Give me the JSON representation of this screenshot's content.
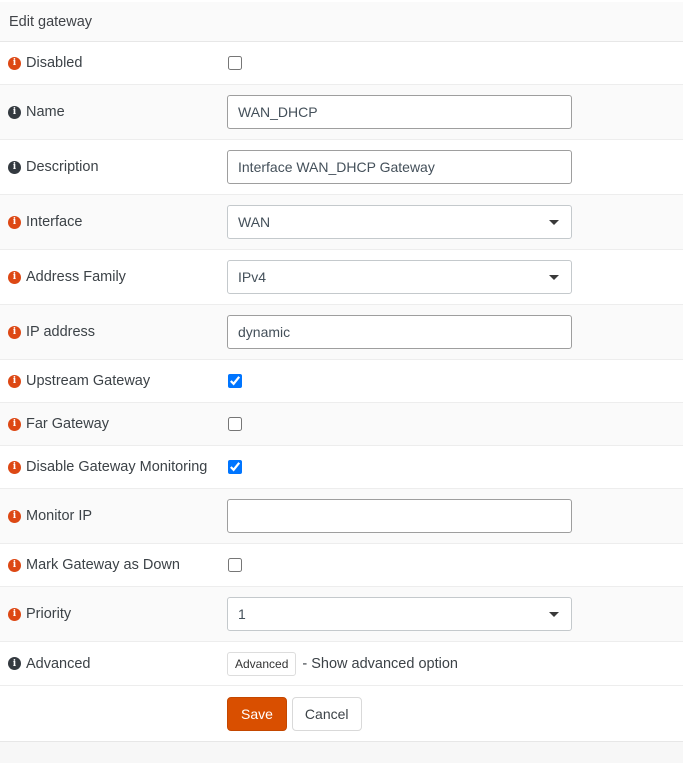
{
  "header": {
    "title": "Edit gateway"
  },
  "colors": {
    "primary": "#d94f00",
    "icon-orange": "#dd4814",
    "icon-dark": "#343a40",
    "checkbox": "#0075ff",
    "stripe": "#fafafa",
    "border": "#ededed"
  },
  "form": {
    "rows": [
      {
        "id": "disabled",
        "label": "Disabled",
        "type": "checkbox",
        "checked": false,
        "icon": "info-icon-orange"
      },
      {
        "id": "name",
        "label": "Name",
        "type": "text",
        "value": "WAN_DHCP",
        "icon": "info-icon-dark"
      },
      {
        "id": "description",
        "label": "Description",
        "type": "text",
        "value": "Interface WAN_DHCP Gateway",
        "icon": "info-icon-dark"
      },
      {
        "id": "interface",
        "label": "Interface",
        "type": "select",
        "value": "WAN",
        "icon": "info-icon-orange"
      },
      {
        "id": "address_family",
        "label": "Address Family",
        "type": "select",
        "value": "IPv4",
        "icon": "info-icon-orange"
      },
      {
        "id": "ip_address",
        "label": "IP address",
        "type": "text",
        "value": "dynamic",
        "icon": "info-icon-orange"
      },
      {
        "id": "upstream_gateway",
        "label": "Upstream Gateway",
        "type": "checkbox",
        "checked": true,
        "icon": "info-icon-orange"
      },
      {
        "id": "far_gateway",
        "label": "Far Gateway",
        "type": "checkbox",
        "checked": false,
        "icon": "info-icon-orange"
      },
      {
        "id": "disable_gateway_monitoring",
        "label": "Disable Gateway Monitoring",
        "type": "checkbox",
        "checked": true,
        "icon": "info-icon-orange"
      },
      {
        "id": "monitor_ip",
        "label": "Monitor IP",
        "type": "text",
        "value": "",
        "icon": "info-icon-orange"
      },
      {
        "id": "mark_gateway_as_down",
        "label": "Mark Gateway as Down",
        "type": "checkbox",
        "checked": false,
        "icon": "info-icon-orange"
      },
      {
        "id": "priority",
        "label": "Priority",
        "type": "select",
        "value": "1",
        "icon": "info-icon-orange"
      },
      {
        "id": "advanced",
        "label": "Advanced",
        "type": "advanced",
        "button_label": "Advanced",
        "note": "- Show advanced option",
        "icon": "info-icon-dark"
      }
    ]
  },
  "actions": {
    "save": "Save",
    "cancel": "Cancel"
  }
}
